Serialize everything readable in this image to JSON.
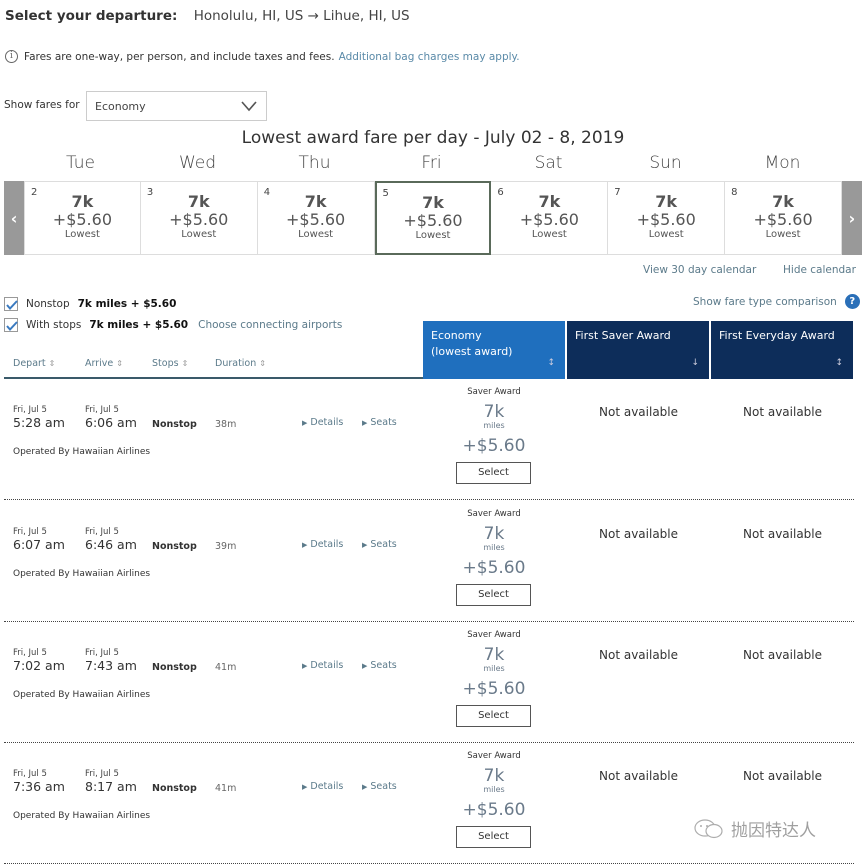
{
  "header": {
    "label": "Select your departure:",
    "route": "Honolulu, HI, US → Lihue, HI, US"
  },
  "info": {
    "icon": "info-icon",
    "text": "Fares are one-way, per person, and include taxes and fees.",
    "link": "Additional bag charges may apply."
  },
  "fare_filter": {
    "label": "Show fares for",
    "selected": "Economy"
  },
  "calendar": {
    "title": "Lowest award fare per day - July 02 - 8, 2019",
    "prev_icon": "chevron-left-icon",
    "next_icon": "chevron-right-icon",
    "days": [
      {
        "name": "Tue",
        "num": "2",
        "miles": "7k",
        "tax": "+$5.60",
        "note": "Lowest",
        "selected": false
      },
      {
        "name": "Wed",
        "num": "3",
        "miles": "7k",
        "tax": "+$5.60",
        "note": "Lowest",
        "selected": false
      },
      {
        "name": "Thu",
        "num": "4",
        "miles": "7k",
        "tax": "+$5.60",
        "note": "Lowest",
        "selected": false
      },
      {
        "name": "Fri",
        "num": "5",
        "miles": "7k",
        "tax": "+$5.60",
        "note": "Lowest",
        "selected": true
      },
      {
        "name": "Sat",
        "num": "6",
        "miles": "7k",
        "tax": "+$5.60",
        "note": "Lowest",
        "selected": false
      },
      {
        "name": "Sun",
        "num": "7",
        "miles": "7k",
        "tax": "+$5.60",
        "note": "Lowest",
        "selected": false
      },
      {
        "name": "Mon",
        "num": "8",
        "miles": "7k",
        "tax": "+$5.60",
        "note": "Lowest",
        "selected": false
      }
    ],
    "view30": "View 30 day calendar",
    "hide": "Hide calendar"
  },
  "filters": {
    "nonstop": {
      "label": "Nonstop",
      "price": "7k miles + $5.60",
      "checked": true
    },
    "with_stops": {
      "label": "With stops",
      "price": "7k miles + $5.60",
      "checked": true,
      "link": "Choose connecting airports"
    },
    "compare": "Show fare type comparison"
  },
  "columns": {
    "depart": "Depart",
    "arrive": "Arrive",
    "stops": "Stops",
    "duration": "Duration"
  },
  "fare_tabs": [
    {
      "line1": "Economy",
      "line2": "(lowest award)",
      "sort": "↕"
    },
    {
      "line1": "First Saver Award",
      "line2": "",
      "sort": "↓"
    },
    {
      "line1": "First Everyday Award",
      "line2": "",
      "sort": "↕"
    }
  ],
  "flights": [
    {
      "ddate": "Fri, Jul 5",
      "dtime": "5:28 am",
      "adate": "Fri, Jul 5",
      "atime": "6:06 am",
      "stops": "Nonstop",
      "duration": "38m",
      "details": "Details",
      "seats": "Seats",
      "operator": "Operated By Hawaiian Airlines",
      "award_type": "Saver Award",
      "miles": "7k",
      "unit": "miles",
      "tax": "+$5.60",
      "select": "Select",
      "first_saver": "Not available",
      "first_everyday": "Not available"
    },
    {
      "ddate": "Fri, Jul 5",
      "dtime": "6:07 am",
      "adate": "Fri, Jul 5",
      "atime": "6:46 am",
      "stops": "Nonstop",
      "duration": "39m",
      "details": "Details",
      "seats": "Seats",
      "operator": "Operated By Hawaiian Airlines",
      "award_type": "Saver Award",
      "miles": "7k",
      "unit": "miles",
      "tax": "+$5.60",
      "select": "Select",
      "first_saver": "Not available",
      "first_everyday": "Not available"
    },
    {
      "ddate": "Fri, Jul 5",
      "dtime": "7:02 am",
      "adate": "Fri, Jul 5",
      "atime": "7:43 am",
      "stops": "Nonstop",
      "duration": "41m",
      "details": "Details",
      "seats": "Seats",
      "operator": "Operated By Hawaiian Airlines",
      "award_type": "Saver Award",
      "miles": "7k",
      "unit": "miles",
      "tax": "+$5.60",
      "select": "Select",
      "first_saver": "Not available",
      "first_everyday": "Not available"
    },
    {
      "ddate": "Fri, Jul 5",
      "dtime": "7:36 am",
      "adate": "Fri, Jul 5",
      "atime": "8:17 am",
      "stops": "Nonstop",
      "duration": "41m",
      "details": "Details",
      "seats": "Seats",
      "operator": "Operated By Hawaiian Airlines",
      "award_type": "Saver Award",
      "miles": "7k",
      "unit": "miles",
      "tax": "+$5.60",
      "select": "Select",
      "first_saver": "Not available",
      "first_everyday": "Not available"
    }
  ],
  "watermark": "抛因特达人"
}
